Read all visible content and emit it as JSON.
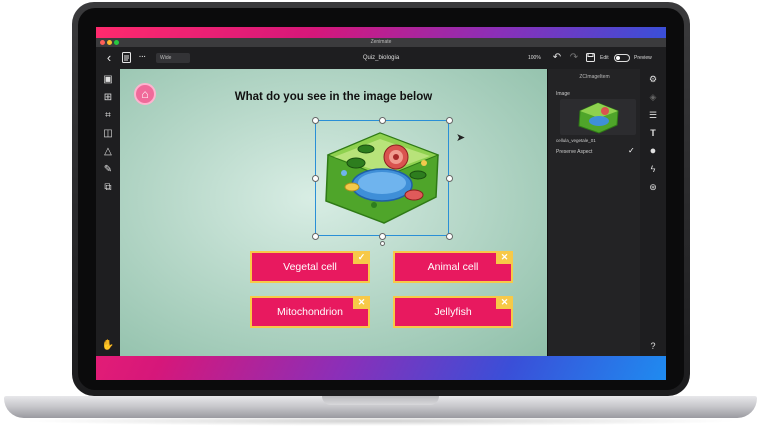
{
  "window": {
    "title": "Zenimate"
  },
  "toolbar": {
    "back_icon": "chevron-left-icon",
    "doc_icon": "document-icon",
    "more_label": "···",
    "dropdown_value": "Wide",
    "project_name": "Quiz_biologia",
    "zoom": "100%",
    "edit_label": "Edit",
    "preview_label": "Preview"
  },
  "left_tools": [
    "image-icon",
    "frame-icon",
    "crop-icon",
    "media-icon",
    "shapes-icon",
    "paint-icon",
    "group-icon"
  ],
  "canvas": {
    "question": "What do you see in the image below",
    "answers": [
      {
        "label": "Vegetal cell",
        "mark": "✓"
      },
      {
        "label": "Animal cell",
        "mark": "✕"
      },
      {
        "label": "Mitochondrion",
        "mark": "✕"
      },
      {
        "label": "Jellyfish",
        "mark": "✕"
      }
    ]
  },
  "right_panel": {
    "title": "ZCImageItem",
    "image_label": "Image",
    "file_name": "cellula_vegetale_01",
    "preserve_aspect_label": "Preserve Aspect",
    "preserve_aspect_checked": true
  },
  "colors": {
    "answer_bg": "#e8195f",
    "answer_border": "#f7c948",
    "selection": "#2a8fd6"
  }
}
